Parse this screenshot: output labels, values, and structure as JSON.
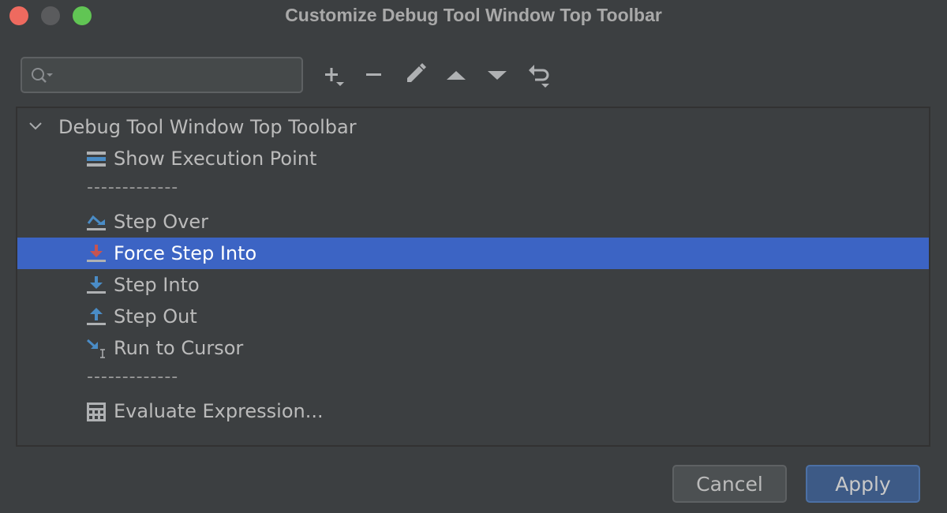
{
  "window": {
    "title": "Customize Debug Tool Window Top Toolbar"
  },
  "search": {
    "value": "",
    "placeholder": "",
    "icon": "search-with-dropdown-icon"
  },
  "toolbar": {
    "buttons": [
      {
        "name": "add",
        "icon": "plus-with-dropdown-icon"
      },
      {
        "name": "remove",
        "icon": "minus-icon"
      },
      {
        "name": "edit",
        "icon": "pencil-icon"
      },
      {
        "name": "move-up",
        "icon": "triangle-up-icon"
      },
      {
        "name": "move-down",
        "icon": "triangle-down-icon"
      },
      {
        "name": "restore",
        "icon": "undo-with-dropdown-icon"
      }
    ]
  },
  "tree": {
    "root": {
      "label": "Debug Tool Window Top Toolbar",
      "expanded": true
    },
    "items": [
      {
        "type": "action",
        "label": "Show Execution Point",
        "icon": "show-execution-point-icon"
      },
      {
        "type": "separator",
        "label": "-------------"
      },
      {
        "type": "action",
        "label": "Step Over",
        "icon": "step-over-icon"
      },
      {
        "type": "action",
        "label": "Force Step Into",
        "icon": "force-step-into-icon",
        "selected": true
      },
      {
        "type": "action",
        "label": "Step Into",
        "icon": "step-into-icon"
      },
      {
        "type": "action",
        "label": "Step Out",
        "icon": "step-out-icon"
      },
      {
        "type": "action",
        "label": "Run to Cursor",
        "icon": "run-to-cursor-icon"
      },
      {
        "type": "separator",
        "label": "-------------"
      },
      {
        "type": "action",
        "label": "Evaluate Expression...",
        "icon": "calculator-icon"
      }
    ]
  },
  "footer": {
    "cancel_label": "Cancel",
    "apply_label": "Apply"
  },
  "colors": {
    "background": "#3c3f41",
    "selection": "#3c64c4",
    "icon_blue": "#4a8cc6",
    "icon_red": "#c75450",
    "apply_button": "#3d5a86"
  }
}
